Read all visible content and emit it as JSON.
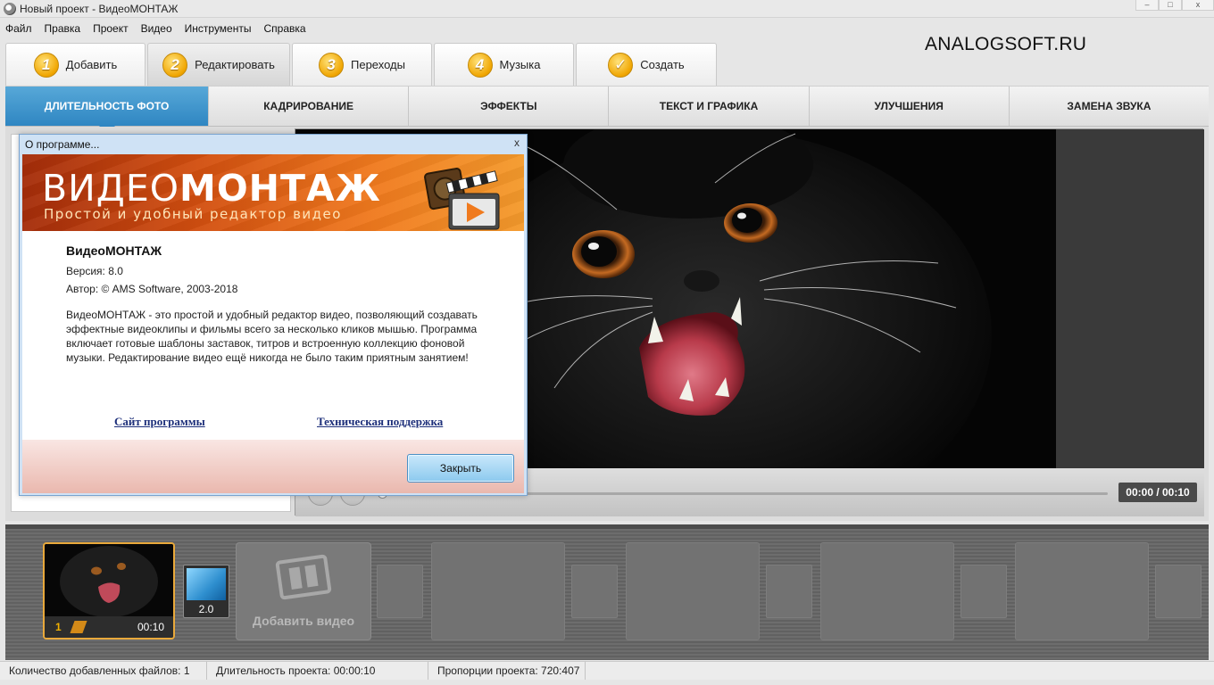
{
  "window": {
    "title": "Новый проект - ВидеоМОНТАЖ"
  },
  "menu": [
    "Файл",
    "Правка",
    "Проект",
    "Видео",
    "Инструменты",
    "Справка"
  ],
  "watermark": "ANALOGSOFT.RU",
  "wizard_tabs": [
    {
      "num": "1",
      "label": "Добавить"
    },
    {
      "num": "2",
      "label": "Редактировать",
      "active": true
    },
    {
      "num": "3",
      "label": "Переходы"
    },
    {
      "num": "4",
      "label": "Музыка"
    },
    {
      "num": "✓",
      "label": "Создать"
    }
  ],
  "sub_tabs": [
    "Длительность фото",
    "Кадрирование",
    "Эффекты",
    "Текст и графика",
    "Улучшения",
    "Замена звука"
  ],
  "player": {
    "timecode": "00:00 / 00:10"
  },
  "timeline": {
    "clip": {
      "index": "1",
      "duration": "00:10"
    },
    "transition": {
      "value": "2.0"
    },
    "add_video_label": "Добавить видео"
  },
  "status": {
    "files_count": "Количество добавленных файлов: 1",
    "duration": "Длительность проекта:  00:00:10",
    "proportions": "Пропорции проекта:   720:407"
  },
  "about": {
    "title": "О программе...",
    "close_glyph": "x",
    "banner_title_light": "ВИДЕО",
    "banner_title_bold": "МОНТАЖ",
    "banner_subtitle": "Простой и удобный редактор видео",
    "app_name": "ВидеоМОНТАЖ",
    "version": "Версия: 8.0",
    "author": "Автор: © AMS Software, 2003-2018",
    "description": "ВидеоМОНТАЖ - это простой и удобный редактор видео, позволяющий создавать эффектные видеоклипы и фильмы всего за несколько кликов мышью. Программа включает готовые шаблоны заставок, титров и встроенную коллекцию фоновой музыки. Редактирование видео ещё никогда не было таким приятным занятием!",
    "link_site": "Сайт программы",
    "link_support": "Техническая поддержка",
    "close_button": "Закрыть"
  },
  "colors": {
    "accent": "#2f86c2",
    "banner": "#d24f10",
    "clip_border": "#e9a93b"
  }
}
